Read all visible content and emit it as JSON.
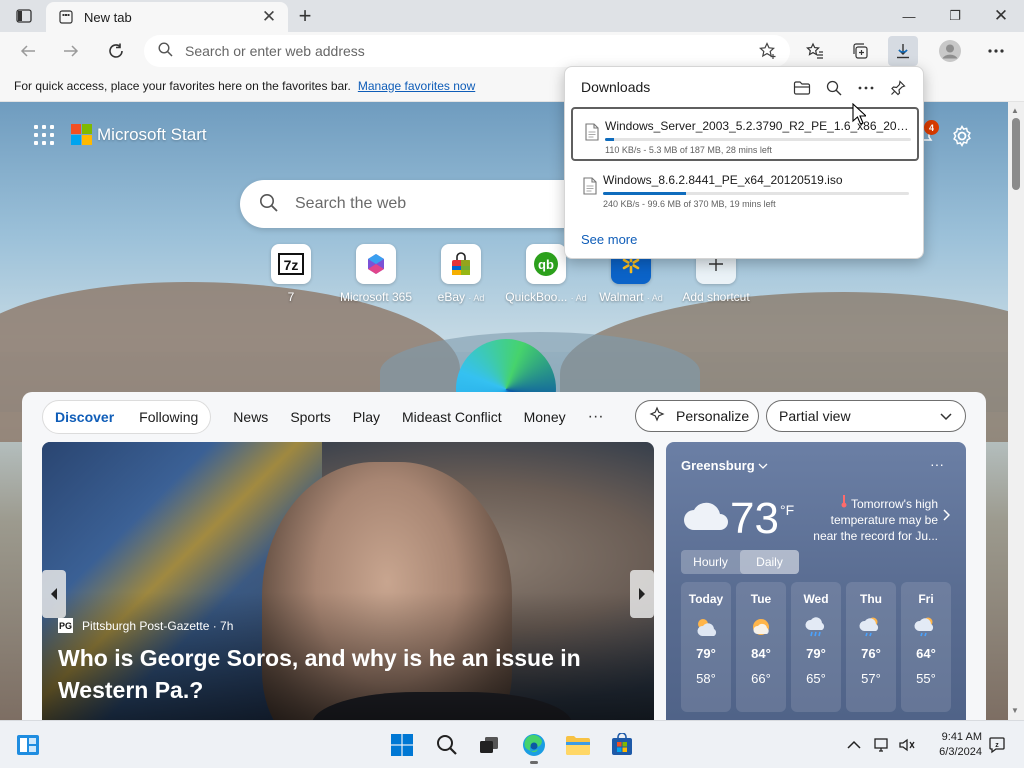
{
  "tab": {
    "title": "New tab",
    "close_glyph": "✕"
  },
  "newtab_glyph": "+",
  "window_controls": {
    "minimize": "—",
    "restore": "❐",
    "close": "✕"
  },
  "address_bar": {
    "placeholder": "Search or enter web address"
  },
  "favorites_bar": {
    "message": "For quick access, place your favorites here on the favorites bar.",
    "link": "Manage favorites now"
  },
  "header": {
    "brand": "Microsoft Start",
    "notification_count": "4"
  },
  "web_search": {
    "placeholder": "Search the web"
  },
  "quick_links": [
    {
      "label": "7",
      "ad": "",
      "icon": "7zip-icon"
    },
    {
      "label": "Microsoft 365",
      "ad": "",
      "icon": "m365-icon"
    },
    {
      "label": "eBay",
      "ad": "· Ad",
      "icon": "ebay-icon"
    },
    {
      "label": "QuickBoo...",
      "ad": "· Ad",
      "icon": "quickbooks-icon"
    },
    {
      "label": "Walmart",
      "ad": "· Ad",
      "icon": "walmart-icon"
    },
    {
      "label": "Add shortcut",
      "ad": "",
      "icon": "plus-icon"
    }
  ],
  "feed": {
    "pills": [
      "Discover",
      "Following"
    ],
    "links": [
      "News",
      "Sports",
      "Play",
      "Mideast Conflict",
      "Money"
    ],
    "more": "···",
    "personalize": "Personalize",
    "view": "Partial view"
  },
  "hero": {
    "source": "Pittsburgh Post-Gazette · 7h",
    "source_logo": "PG",
    "headline": "Who is George Soros, and why is he an issue in Western Pa.?"
  },
  "weather": {
    "location": "Greensburg",
    "more": "···",
    "temperature": "73",
    "unit": "°F",
    "alert": "Tomorrow's high temperature may be near the record for Ju...",
    "toggle": [
      "Hourly",
      "Daily"
    ],
    "days": [
      {
        "name": "Today",
        "hi": "79°",
        "lo": "58°",
        "icon": "partly-cloudy-icon"
      },
      {
        "name": "Tue",
        "hi": "84°",
        "lo": "66°",
        "icon": "sunny-icon"
      },
      {
        "name": "Wed",
        "hi": "79°",
        "lo": "65°",
        "icon": "rain-icon"
      },
      {
        "name": "Thu",
        "hi": "76°",
        "lo": "57°",
        "icon": "partly-cloudy-rain-icon"
      },
      {
        "name": "Fri",
        "hi": "64°",
        "lo": "55°",
        "icon": "partly-cloudy-rain-icon"
      }
    ]
  },
  "downloads": {
    "title": "Downloads",
    "items": [
      {
        "name": "Windows_Server_2003_5.2.3790_R2_PE_1.6_x86_200503...",
        "status": "110 KB/s - 5.3 MB of 187 MB, 28 mins left",
        "progress": 0.03
      },
      {
        "name": "Windows_8.6.2.8441_PE_x64_20120519.iso",
        "status": "240 KB/s - 99.6 MB of 370 MB, 19 mins left",
        "progress": 0.27
      }
    ],
    "see_more": "See more"
  },
  "clock": {
    "time": "9:41 AM",
    "date": "6/3/2024"
  },
  "colors": {
    "accent": "#0f6cbd",
    "link": "#0f5db8",
    "badge": "#d83b01"
  }
}
